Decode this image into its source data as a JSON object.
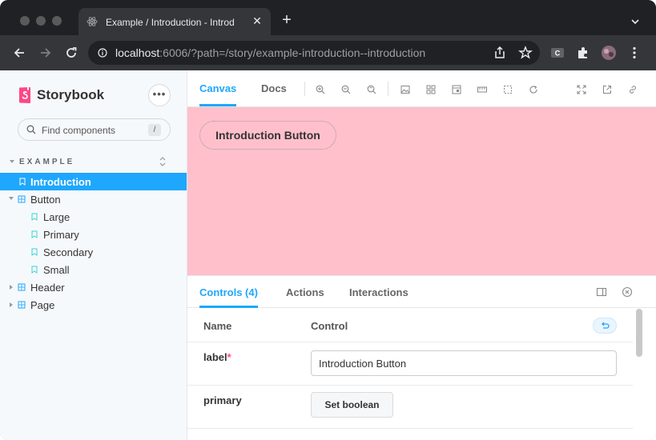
{
  "browser": {
    "tab_title": "Example / Introduction - Introd",
    "tab_close": "✕",
    "new_tab": "+",
    "url_host": "localhost",
    "url_rest": ":6006/?path=/story/example-introduction--introduction"
  },
  "sidebar": {
    "brand": "Storybook",
    "menu_label": "•••",
    "search_placeholder": "Find components",
    "search_shortcut": "/",
    "section_label": "EXAMPLE",
    "items": [
      {
        "label": "Introduction",
        "type": "story",
        "active": true
      },
      {
        "label": "Button",
        "type": "component",
        "expanded": true
      },
      {
        "label": "Large",
        "type": "story"
      },
      {
        "label": "Primary",
        "type": "story"
      },
      {
        "label": "Secondary",
        "type": "story"
      },
      {
        "label": "Small",
        "type": "story"
      },
      {
        "label": "Header",
        "type": "component",
        "expanded": false
      },
      {
        "label": "Page",
        "type": "component",
        "expanded": false
      }
    ]
  },
  "main": {
    "tabs": [
      "Canvas",
      "Docs"
    ],
    "active_tab": "Canvas",
    "canvas_color": "#ffc0cb",
    "demo_button_label": "Introduction Button"
  },
  "addons": {
    "tabs": [
      "Controls (4)",
      "Actions",
      "Interactions"
    ],
    "active_tab": "Controls (4)",
    "columns": [
      "Name",
      "Control"
    ],
    "rows": [
      {
        "name": "label",
        "required": "*",
        "value": "Introduction Button"
      },
      {
        "name": "primary",
        "button": "Set boolean"
      }
    ]
  },
  "colors": {
    "accent": "#1ea7fd",
    "storybook_pink": "#ff4785"
  }
}
